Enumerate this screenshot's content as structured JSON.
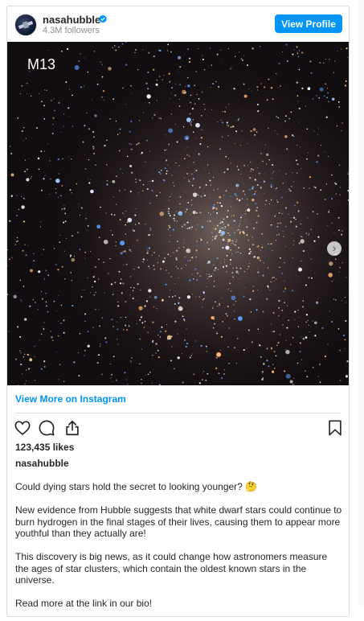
{
  "header": {
    "username": "nasahubble",
    "followers": "4.3M followers",
    "view_profile_label": "View Profile"
  },
  "post": {
    "image_label": "M13",
    "view_more_label": "View More on Instagram",
    "likes": "123,435 likes",
    "caption_username": "nasahubble",
    "caption_paragraphs": [
      "Could dying stars hold the secret to looking younger? 🤔",
      "New evidence from Hubble suggests that white dwarf stars could continue to burn hydrogen in the final stages of their lives, causing them to appear more youthful than they actually are!",
      "This discovery is big news, as it could change how astronomers measure the ages of star clusters, which contain the oldest known stars in the universe.",
      "Read more at the link in our bio!"
    ]
  },
  "icons": {
    "verified": "verified-badge-icon",
    "like": "heart-icon",
    "comment": "comment-icon",
    "share": "share-icon",
    "save": "bookmark-icon",
    "next": "chevron-right-icon"
  },
  "colors": {
    "accent": "#0095f6",
    "text": "#262626",
    "muted": "#8e8e8e",
    "border": "#dbdbdb"
  }
}
